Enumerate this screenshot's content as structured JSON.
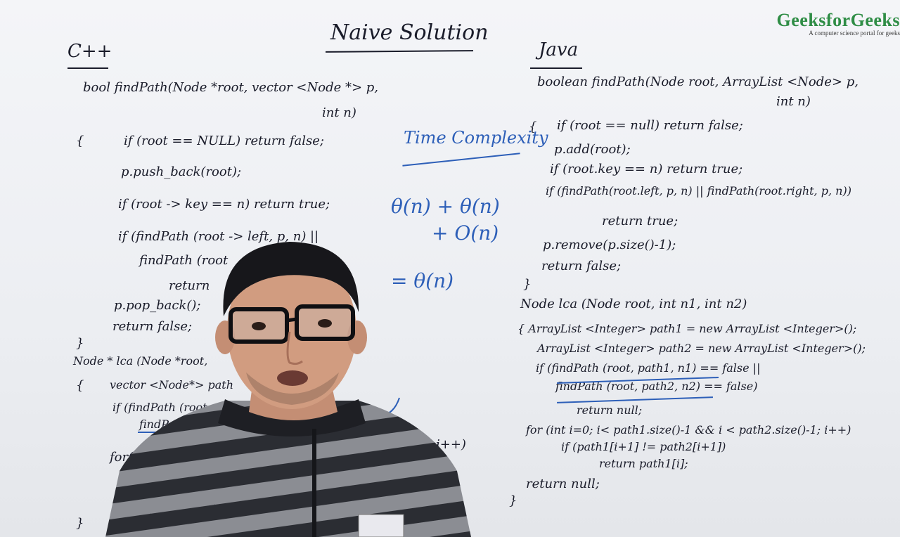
{
  "logo": {
    "name": "GeeksforGeeks",
    "tagline": "A computer science portal for geeks"
  },
  "title": "Naive Solution",
  "left": {
    "lang": "C++",
    "lines": [
      "bool findPath(Node *root, vector <Node *> p,",
      "int n)",
      "{",
      "if (root == NULL) return false;",
      "p.push_back(root);",
      "if (root -> key == n) return true;",
      "if (findPath (root -> left, p, n) ||",
      "findPath (root",
      "return",
      "p.pop_back();",
      "return false;",
      "}",
      "Node * lca (Node *root,",
      "{",
      "vector <Node*> path",
      "if (findPath (root,",
      "findPath (ro",
      "i++)",
      "for(i",
      "}"
    ]
  },
  "middle": {
    "heading": "Time Complexity",
    "line1": "θ(n) + θ(n)",
    "line2": "+ O(n)",
    "line3": "= θ(n)"
  },
  "right": {
    "lang": "Java",
    "lines": [
      "boolean findPath(Node root, ArrayList <Node> p,",
      "int n)",
      "{",
      "if (root == null) return false;",
      "p.add(root);",
      "if (root.key == n) return true;",
      "if (findPath(root.left, p, n) || findPath(root.right, p, n))",
      "return true;",
      "p.remove(p.size()-1);",
      "return false;",
      "}",
      "Node lca (Node root, int n1, int n2)",
      "{ ArrayList <Integer> path1 = new ArrayList <Integer>();",
      "ArrayList <Integer> path2 = new ArrayList <Integer>();",
      "if (findPath (root, path1, n1) == false ||",
      "findPath (root, path2, n2) == false)",
      "return null;",
      "for (int i=0; i< path1.size()-1 && i < path2.size()-1; i++)",
      "if (path1[i+1] != path2[i+1])",
      "return path1[i];",
      "return null;",
      "}"
    ]
  },
  "colors": {
    "board": "#eef0f3",
    "ink": "#1a1c2a",
    "blue_ink": "#2d5fb8",
    "logo": "#2f8d46"
  }
}
